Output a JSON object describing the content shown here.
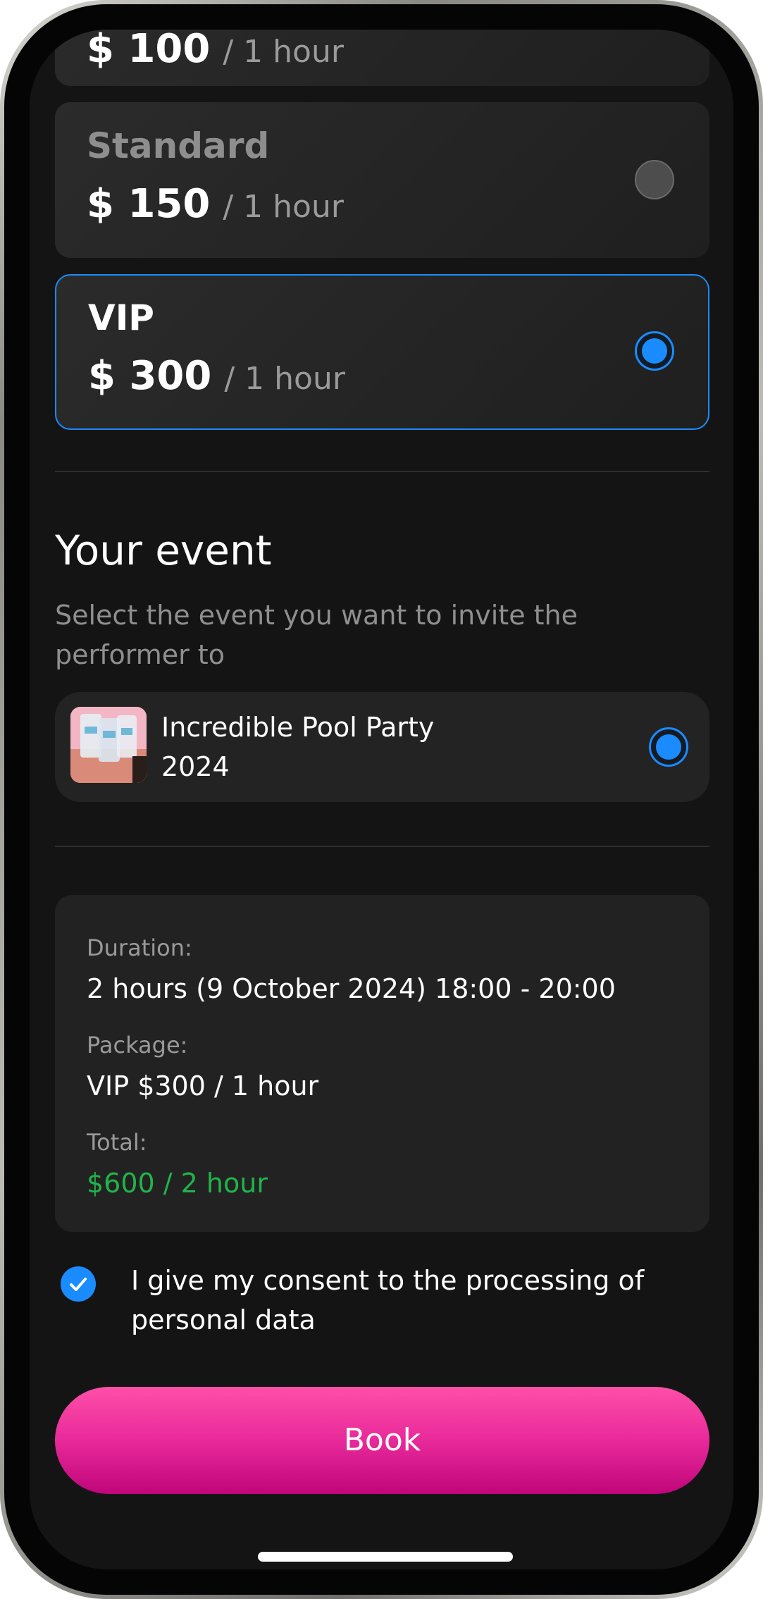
{
  "packages": [
    {
      "name": "",
      "price": "$ 100",
      "unit": "/ 1 hour",
      "selected": false
    },
    {
      "name": "Standard",
      "price": "$ 150",
      "unit": "/ 1 hour",
      "selected": false
    },
    {
      "name": "VIP",
      "price": "$ 300",
      "unit": "/ 1 hour",
      "selected": true
    }
  ],
  "event_section": {
    "title": "Your event",
    "subtitle": "Select the event you want to invite the performer to",
    "event": {
      "name": "Incredible Pool Party 2024",
      "selected": true
    }
  },
  "summary": {
    "duration_label": "Duration:",
    "duration_value": "2 hours (9 October 2024)  18:00 - 20:00",
    "package_label": "Package:",
    "package_value": "VIP  $300 / 1 hour",
    "total_label": "Total:",
    "total_value": "$600 / 2 hour"
  },
  "consent": {
    "checked": true,
    "text": "I give my consent to the processing of personal data"
  },
  "book_label": "Book",
  "colors": {
    "accent": "#1a8cff",
    "total": "#21b34a",
    "book_gradient_start": "#ff4fa8",
    "book_gradient_end": "#c0067a",
    "background": "#141414"
  }
}
